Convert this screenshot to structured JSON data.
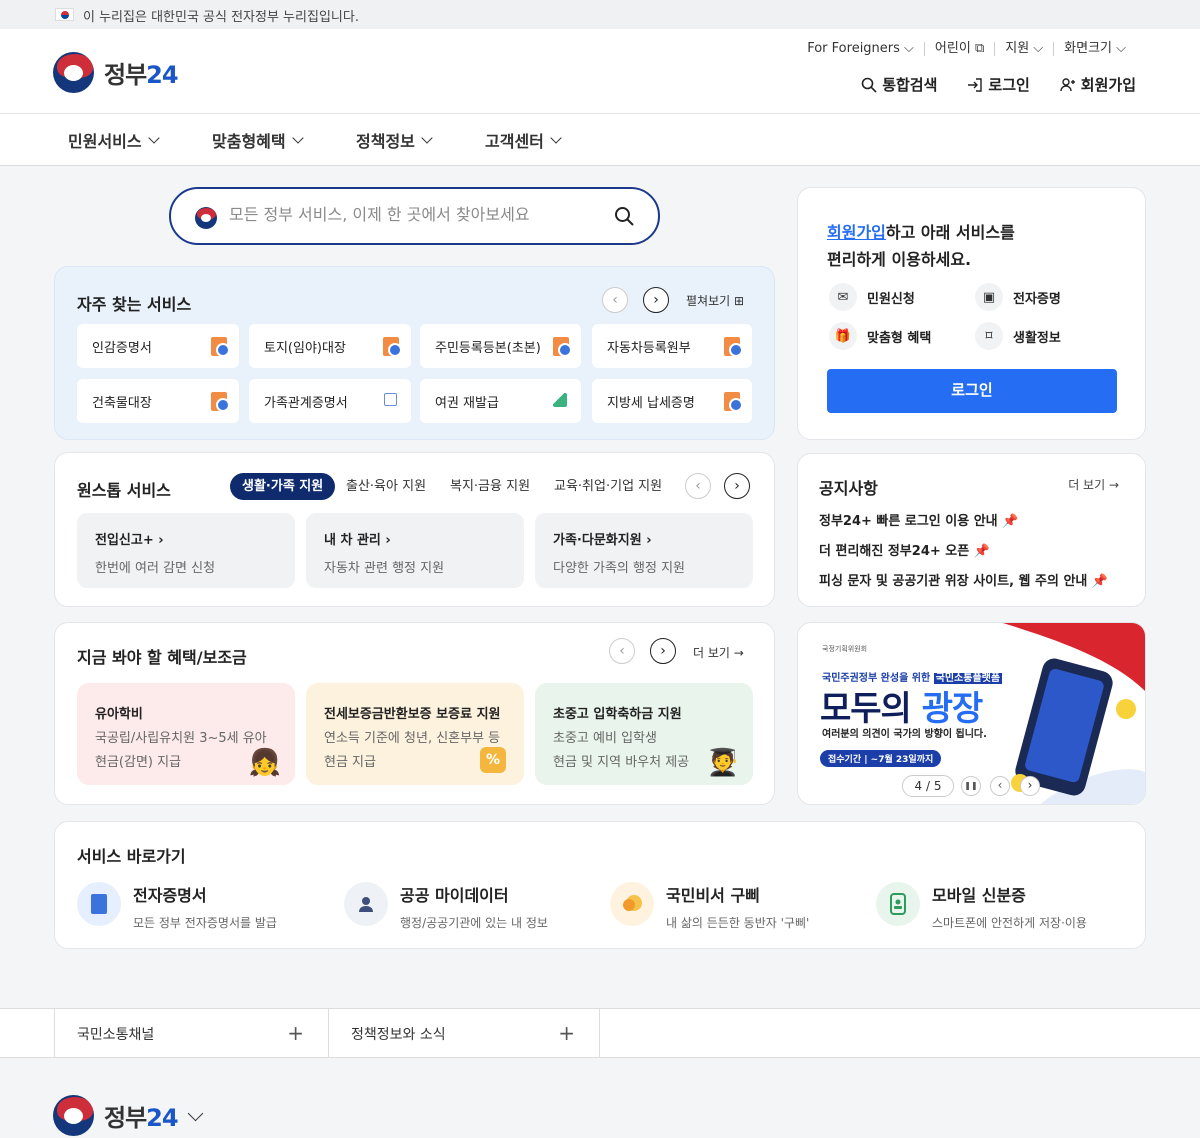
{
  "top_notice": "이 누리집은 대한민국 공식 전자정부 누리집입니다.",
  "logo": {
    "text_a": "정부",
    "text_b": "24"
  },
  "util_links": [
    "For Foreigners",
    "어린이",
    "지원",
    "화면크기"
  ],
  "header_actions": {
    "search": "통합검색",
    "login": "로그인",
    "signup": "회원가입"
  },
  "gnb": [
    "민원서비스",
    "맞춤형혜택",
    "정책정보",
    "고객센터"
  ],
  "search": {
    "placeholder": "모든 정부 서비스, 이제 한 곳에서 찾아보세요"
  },
  "frequent": {
    "title": "자주 찾는 서비스",
    "expand": "펼쳐보기",
    "items": [
      "인감증명서",
      "토지(임야)대장",
      "주민등록등본(초본)",
      "자동차등록원부",
      "건축물대장",
      "가족관계증명서",
      "여권 재발급",
      "지방세 납세증명"
    ]
  },
  "onestop": {
    "title": "원스톱 서비스",
    "tabs": [
      "생활·가족 지원",
      "출산·육아 지원",
      "복지·금융 지원",
      "교육·취업·기업 지원"
    ],
    "cards": [
      {
        "title": "전입신고+",
        "desc": "한번에 여러 감면 신청"
      },
      {
        "title": "내 차 관리",
        "desc": "자동차 관련 행정 지원"
      },
      {
        "title": "가족·다문화지원",
        "desc": "다양한 가족의 행정 지원"
      }
    ]
  },
  "benefits": {
    "title": "지금 봐야 할 혜택/보조금",
    "more": "더 보기",
    "cards": [
      {
        "title": "유아학비",
        "desc1": "국공립/사립유치원 3~5세 유아",
        "desc2": "현금(감면) 지급"
      },
      {
        "title": "전세보증금반환보증 보증료 지원",
        "desc1": "연소득 기준에 청년, 신혼부부 등",
        "desc2": "현금 지급"
      },
      {
        "title": "초중고 입학축하금 지원",
        "desc1": "초중고 예비 입학생",
        "desc2": "현금 및 지역 바우처 제공"
      }
    ]
  },
  "login_card": {
    "link": "회원가입",
    "line1_rest": "하고 아래 서비스를",
    "line2": "편리하게 이용하세요.",
    "services": [
      "민원신청",
      "전자증명",
      "맞춤형 혜택",
      "생활정보"
    ],
    "button": "로그인"
  },
  "notice": {
    "title": "공지사항",
    "more": "더 보기",
    "items": [
      "정부24+ 빠른 로그인 이용 안내",
      "더 편리해진 정부24+ 오픈",
      "피싱 문자 및 공공기관 위장 사이트, 웹 주의 안내"
    ]
  },
  "banner": {
    "org": "국정기획위원회",
    "sub_a": "국민주권정부 완성을 위한",
    "sub_b": "국민소통플랫폼",
    "title_a": "모두의",
    "title_b": "광장",
    "desc": "여러분의 의견이 국가의 방향이 됩니다.",
    "period": "접수기간 | ~7월 23일까지",
    "counter": "4 / 5",
    "pause_icon": "pause-icon"
  },
  "quick": {
    "title": "서비스 바로가기",
    "items": [
      {
        "title": "전자증명서",
        "desc": "모든 정부 전자증명서를 발급"
      },
      {
        "title": "공공 마이데이터",
        "desc": "행정/공공기관에 있는 내 정보"
      },
      {
        "title": "국민비서 구삐",
        "desc": "내 삶의 든든한 동반자 '구삐'"
      },
      {
        "title": "모바일 신분증",
        "desc": "스마트폰에 안전하게 저장·이용"
      }
    ]
  },
  "footer_links": [
    "국민소통채널",
    "정책정보와 소식"
  ],
  "colors": {
    "primary": "#256ef4",
    "navy": "#0f2b6e",
    "accent_red": "#cd2e3a"
  }
}
